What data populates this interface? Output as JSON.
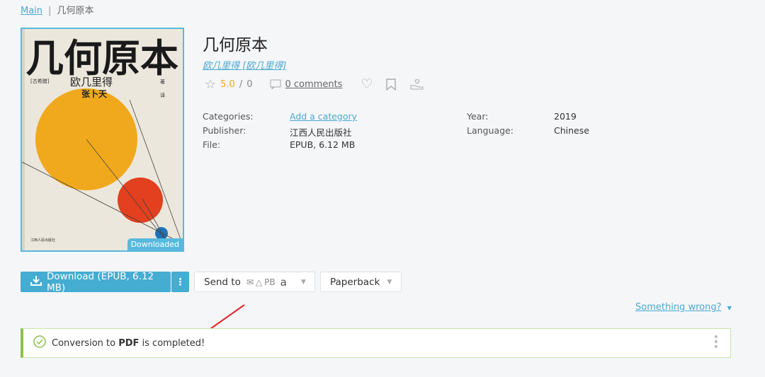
{
  "breadcrumb": {
    "home": "Main",
    "current": "几何原本"
  },
  "book": {
    "title": "几何原本",
    "author_link": "欧几里得 [欧几里得]",
    "rating": "5.0",
    "rating_sep": "/",
    "rating_count": "0",
    "comments": "0 comments",
    "badge": "Downloaded",
    "cover": {
      "title": "几何原本",
      "author": "欧几里得",
      "translator": "张卜天",
      "series": "[古希腊]",
      "role1": "著",
      "role2": "译",
      "publisher": "江西人民出版社"
    }
  },
  "properties": {
    "categories_label": "Categories:",
    "categories_value": "Add a category",
    "publisher_label": "Publisher:",
    "publisher_value": "江西人民出版社",
    "file_label": "File:",
    "file_value": "EPUB, 6.12 MB",
    "year_label": "Year:",
    "year_value": "2019",
    "language_label": "Language:",
    "language_value": "Chinese"
  },
  "actions": {
    "download": "Download (EPUB, 6.12 MB)",
    "send_to": "Send to",
    "send_pb": "PB",
    "send_amazon": "a",
    "paperback": "Paperback",
    "something_wrong": "Something wrong?"
  },
  "alert": {
    "prefix": "Conversion to ",
    "format": "PDF",
    "suffix": " is completed!"
  },
  "colors": {
    "accent": "#45acd2",
    "success": "#8bc34a",
    "rating": "#f5a623"
  }
}
